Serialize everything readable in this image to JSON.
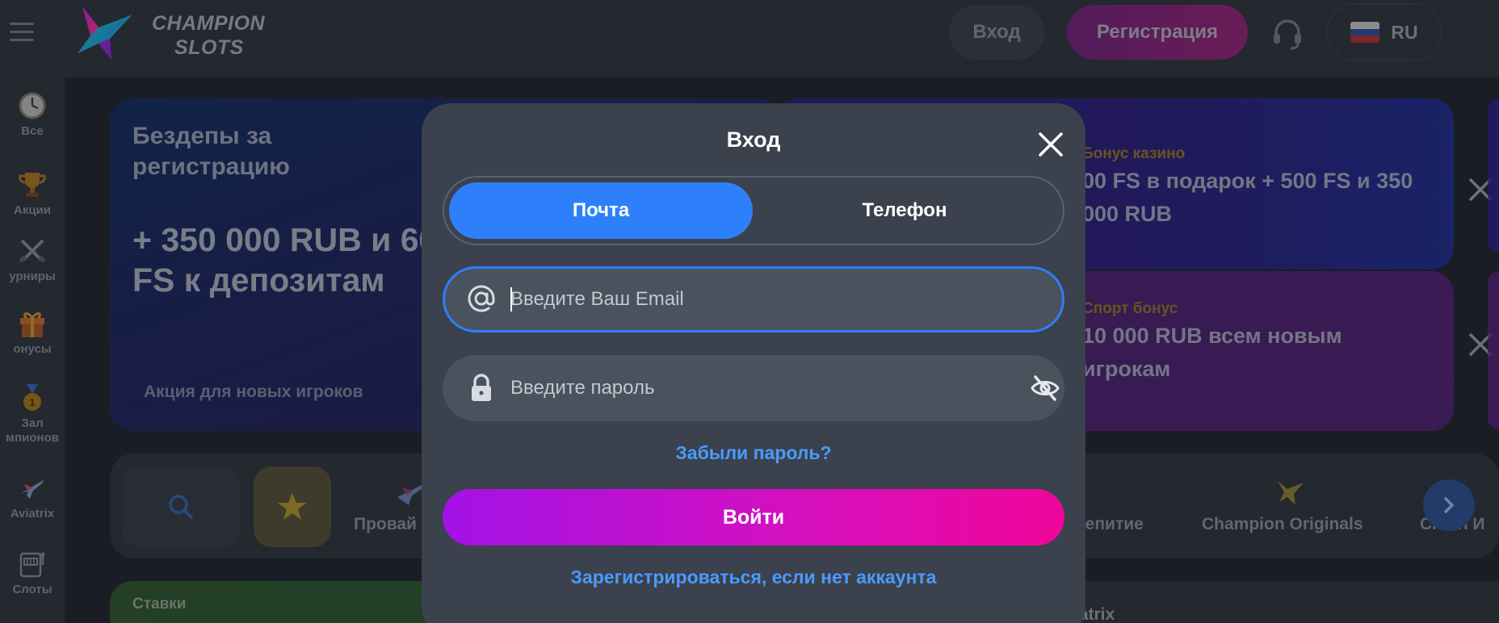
{
  "header": {
    "logo_line1": "CHAMPION",
    "logo_line2": "SLOTS",
    "login_label": "Вход",
    "register_label": "Регистрация",
    "language": "RU"
  },
  "sidebar": {
    "items": [
      {
        "label": "Все",
        "icon": "clock-icon"
      },
      {
        "label": "Акции",
        "icon": "trophy-icon"
      },
      {
        "label": "урниры",
        "icon": "swords-icon"
      },
      {
        "label": "онусы",
        "icon": "gift-icon"
      },
      {
        "label": "Зал\nмпионов",
        "icon": "medal-icon"
      },
      {
        "label": "Aviatrix",
        "icon": "plane-icon"
      },
      {
        "label": "Слоты",
        "icon": "slot-machine-icon"
      }
    ]
  },
  "banners": {
    "main": {
      "title": "Бездепы за регистрацию",
      "big_text": "+ 350 000 RUB и 600 FS к депозитам",
      "note": "Акция для новых игроков"
    },
    "casino": {
      "label": "Бонус казино",
      "text": "00 FS в подарок + 500 FS и 350 000 RUB"
    },
    "sport": {
      "label": "Спорт бонус",
      "text": "10 000 RUB всем новым игрокам"
    }
  },
  "categories": {
    "providers": "Провай",
    "drinking": "аепитие",
    "originals": "Champion Originals",
    "crash": "Crash И"
  },
  "bottom": {
    "bets_label": "Ставки",
    "aviatrix_label": "iatrix"
  },
  "modal": {
    "title": "Вход",
    "tab_email": "Почта",
    "tab_phone": "Телефон",
    "email_placeholder": "Введите Ваш Email",
    "password_placeholder": "Введите пароль",
    "forgot_label": "Забыли пароль?",
    "submit_label": "Войти",
    "register_link": "Зарегистрироваться, если нет аккаунта"
  },
  "colors": {
    "accent_blue": "#2d80fa",
    "link_blue": "#4a9bff",
    "submit_gradient_start": "#a312e6",
    "submit_gradient_end": "#f0069a",
    "modal_bg": "#3b414d"
  }
}
